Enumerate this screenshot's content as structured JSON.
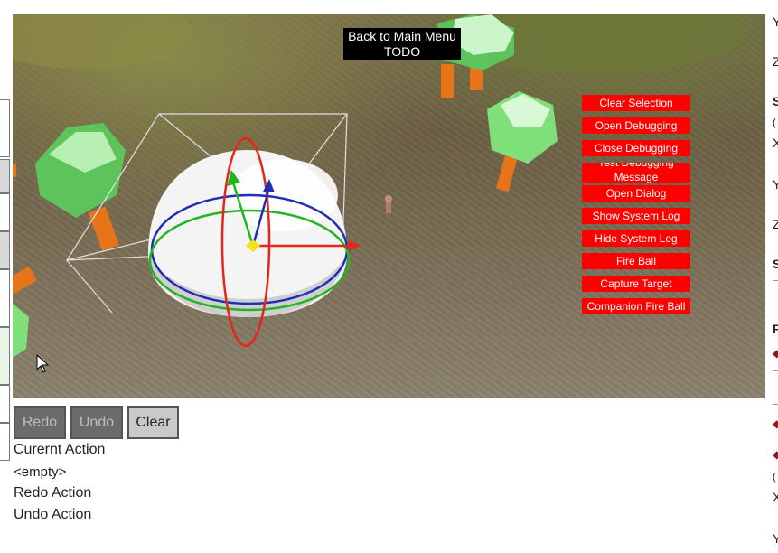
{
  "viewport": {
    "back_button": "Back to Main Menu TODO",
    "actions": [
      "Clear Selection",
      "Open Debugging",
      "Close Debugging",
      "Test Debugging Message",
      "Open Dialog",
      "Show System Log",
      "Hide System Log",
      "Fire Ball",
      "Capture Target",
      "Companion Fire Ball"
    ]
  },
  "history": {
    "redo_label": "Redo",
    "undo_label": "Undo",
    "clear_label": "Clear",
    "current_action_label": "Curernt Action",
    "current_action_value": "<empty>",
    "redo_action_label": "Redo Action",
    "undo_action_label": "Undo Action"
  },
  "right_panel": {
    "labels": [
      "Y",
      "Z",
      "S",
      "(",
      "X",
      "Y",
      "Z",
      "S",
      "F",
      "(",
      "X",
      "Y"
    ]
  },
  "colors": {
    "action_button": "#ff0000",
    "gizmo_x": "#e8241c",
    "gizmo_y": "#22b522",
    "gizmo_z": "#1f2fb5",
    "gizmo_center": "#f0e21c",
    "tree_foliage": "#7fe07a",
    "tree_trunk": "#e8741a"
  }
}
